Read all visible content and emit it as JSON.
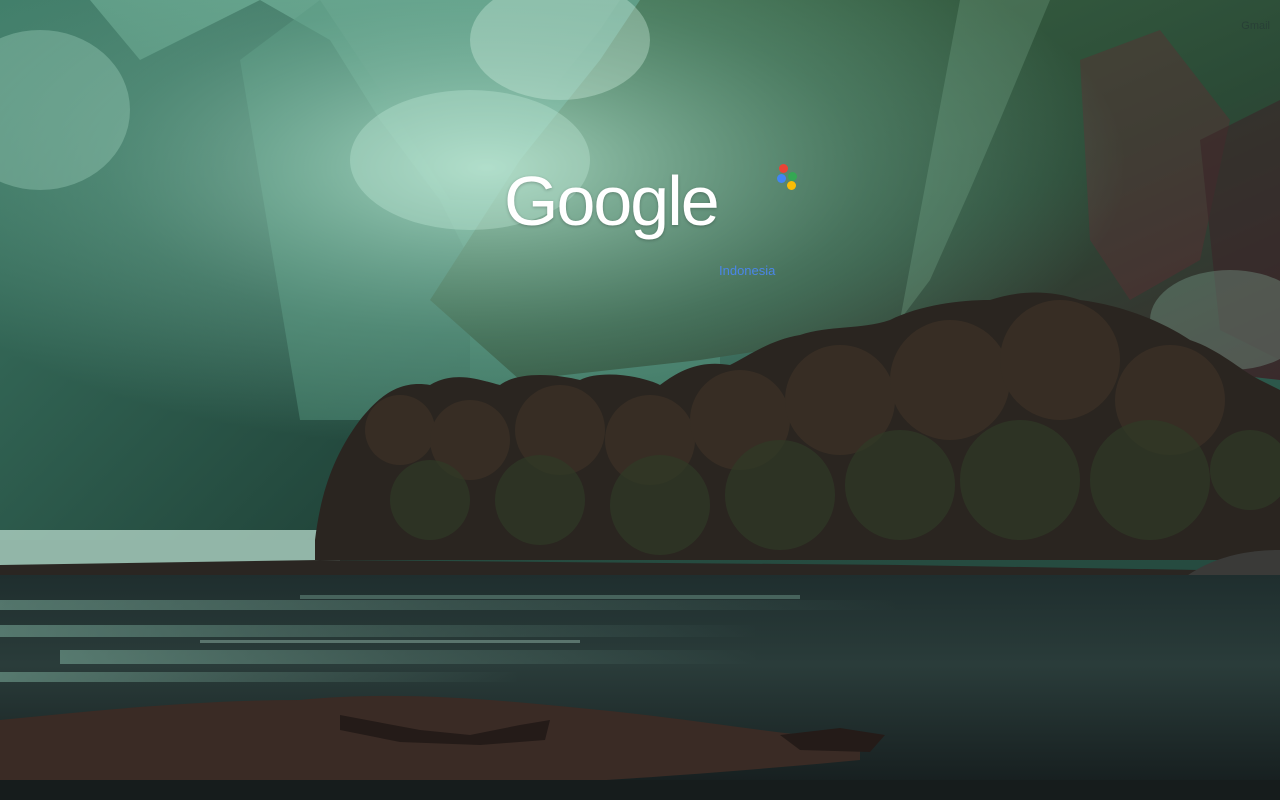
{
  "logo": {
    "wordmark": "Google",
    "region": "Indonesia",
    "dot_colors": [
      "#ea4335",
      "#34a853",
      "#4285f4",
      "#fbbc05"
    ]
  },
  "top_right_link": "Gmail",
  "background": {
    "icon": "landscape-photo"
  }
}
